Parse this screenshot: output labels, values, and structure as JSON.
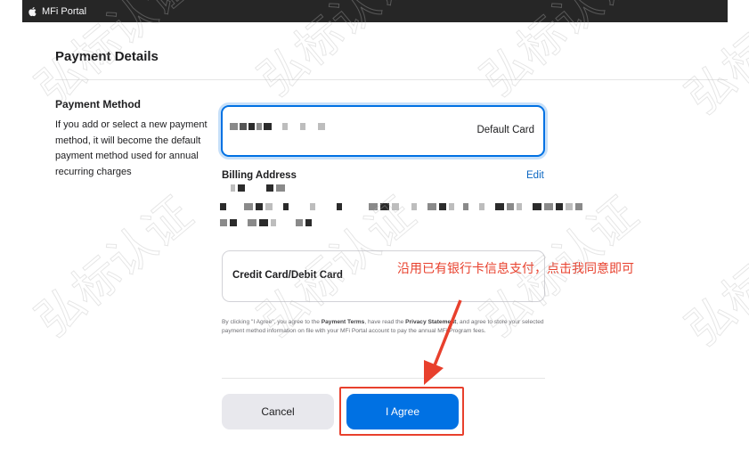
{
  "app": {
    "title": "MFi Portal",
    "logo_icon": "apple-logo-icon"
  },
  "page": {
    "title": "Payment Details"
  },
  "payment_method": {
    "heading": "Payment Method",
    "description": "If you add or select a new payment method, it will become the default payment method used for annual recurring charges"
  },
  "selected_card": {
    "default_label": "Default Card"
  },
  "billing": {
    "label": "Billing Address",
    "edit_label": "Edit"
  },
  "new_card": {
    "label": "Credit Card/Debit Card"
  },
  "legal": {
    "prefix": "By clicking \"I Agree\", you agree to the ",
    "terms": "Payment Terms",
    "middle": ", have read the ",
    "privacy": "Privacy Statement",
    "suffix": ", and agree to store your selected payment method information on file with your MFi Portal account to pay the annual MFi Program fees."
  },
  "actions": {
    "cancel_label": "Cancel",
    "agree_label": "I Agree"
  },
  "annotation": {
    "text": "沿用已有银行卡信息支付，点击我同意即可"
  },
  "watermark": {
    "text": "弘标认证"
  },
  "colors": {
    "accent": "#0071e3",
    "annotation": "#e8402d",
    "topbar": "#262626"
  }
}
